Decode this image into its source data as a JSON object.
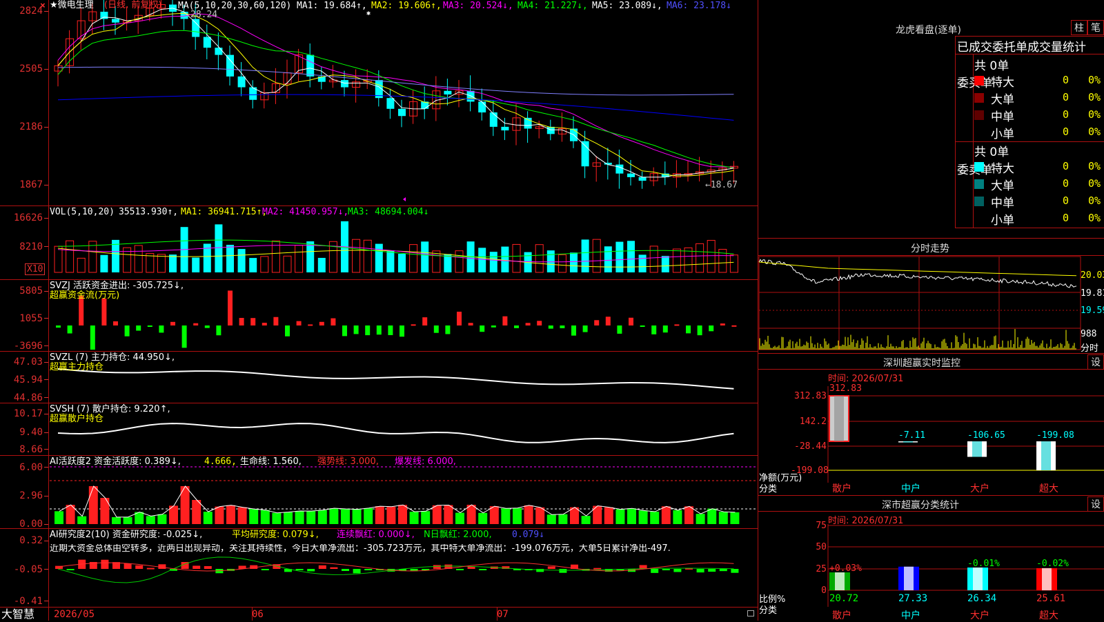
{
  "colors": {
    "up": "#ff2020",
    "down": "#00ffff",
    "ma1": "#ffffff",
    "ma2": "#ffff00",
    "ma3": "#ff00ff",
    "ma4": "#00ff00",
    "ma5": "#8080ff",
    "ma6": "#0000ff",
    "grid": "#b01010",
    "axis": "#e03030"
  },
  "main": {
    "close_icon": "×",
    "title_star": "★微电生理",
    "title_mode": "(日线, 前复权)",
    "ma_params": "MA(5,10,20,30,60,120)",
    "ma1": "MA1: 19.684↑,",
    "ma2": "MA2: 19.606↑,",
    "ma3": "MA3: 20.524↓,",
    "ma4": "MA4: 21.227↓,",
    "ma5": "MA5: 23.089↓,",
    "ma6": "MA6: 23.178↓",
    "high_marker": "28.24",
    "low_marker": "←18.67",
    "y_labels": [
      "2824",
      "2505",
      "2186",
      "1867"
    ]
  },
  "vol": {
    "title": "VOL(5,10,20)",
    "value": "35513.930↑,",
    "ma1": "MA1: 36941.715↑,",
    "ma2": "MA2: 41450.957↓,",
    "ma3": "MA3: 48694.004↓",
    "y_labels": [
      "16626",
      "8210"
    ],
    "unit": "X10"
  },
  "svzj": {
    "title": "SVZJ  活跃资金进出: -305.725↓,",
    "subtitle": "超赢资金流(万元)",
    "y_labels": [
      "5805",
      "1055",
      "-3696"
    ]
  },
  "svzl": {
    "title": "SVZL (7) 主力持仓: 44.950↓,",
    "subtitle": "超赢主力持仓",
    "y_labels": [
      "47.03",
      "45.94",
      "44.86"
    ]
  },
  "svsh": {
    "title": "SVSH (7) 散户持仓: 9.220↑,",
    "subtitle": "超赢散户持仓",
    "y_labels": [
      "10.17",
      "9.40",
      "8.66"
    ]
  },
  "ai1": {
    "title": "AI活跃度2 资金活跃度: 0.389↓,",
    "v2": "4.666,",
    "life": "生命线: 1.560,",
    "strong": "强势线: 3.000,",
    "burst": "爆发线: 6.000,",
    "y_labels": [
      "6.00",
      "2.96",
      "0.00"
    ]
  },
  "ai2": {
    "title": "AI研究度2(10) 资金研究度: -0.025↓,",
    "avg": "平均研究度: 0.079↓,",
    "cont": "连续飘红: 0.000↓,",
    "nday": "N日飘红: 2.000,",
    "last": "0.079↓",
    "comment": "近期大资金总体由空转多，近两日出现异动，关注其持续性，今日大单净流出：-305.723万元，其中特大单净流出：-199.076万元，大单5日累计净出-497.",
    "y_labels": [
      "0.32",
      "-0.05",
      "-0.41"
    ]
  },
  "bottom": {
    "brand": "大智慧",
    "x_labels": [
      "2026/05",
      "06",
      "07"
    ]
  },
  "dragon": {
    "title": "龙虎看盘(逐单)",
    "btn_bar": "柱",
    "btn_pen": "笔",
    "tabs": [
      "已成交",
      "委托单",
      "成交量统计"
    ],
    "buy_label": "委买单",
    "sell_label": "委卖单",
    "buy_total": "共 0单",
    "sell_total": "共 0单",
    "rows": [
      "特大",
      "大单",
      "中单",
      "小单"
    ],
    "buy_rows": [
      {
        "count": "0",
        "pct": "0%"
      },
      {
        "count": "0",
        "pct": "0%"
      },
      {
        "count": "0",
        "pct": "0%"
      },
      {
        "count": "0",
        "pct": "0%"
      }
    ],
    "sell_rows": [
      {
        "count": "0",
        "pct": "0%"
      },
      {
        "count": "0",
        "pct": "0%"
      },
      {
        "count": "0",
        "pct": "0%"
      },
      {
        "count": "0",
        "pct": "0%"
      }
    ],
    "buy_colors": [
      "#ff0000",
      "#8b0000",
      "#600000",
      ""
    ],
    "sell_colors": [
      "#00ffff",
      "#008080",
      "#006060",
      ""
    ]
  },
  "intraday": {
    "title": "分时走势",
    "y_labels": [
      "20.03",
      "19.81",
      "19.59",
      "988"
    ],
    "footer": "分时"
  },
  "monitor": {
    "title": "深圳超赢实时监控",
    "btn": "设",
    "time": "时间: 2026/07/31",
    "y_labels": [
      "312.83",
      "142.2",
      "-28.44",
      "-199.08"
    ],
    "axis_title": "净额(万元)",
    "axis_cat": "分类",
    "categories": [
      "散户",
      "中户",
      "大户",
      "超大"
    ],
    "values": [
      "312.83",
      "-7.11",
      "-106.65",
      "-199.08"
    ]
  },
  "classify": {
    "title": "深市超赢分类统计",
    "btn": "设",
    "time": "时间: 2026/07/31",
    "y_labels": [
      "75",
      "50",
      "25",
      "0"
    ],
    "axis_title": "比例%",
    "axis_cat": "分类",
    "categories": [
      "散户",
      "中户",
      "大户",
      "超大"
    ],
    "changes": [
      "+0.03%",
      "",
      "-0.01%",
      "-0.02%"
    ],
    "values": [
      "20.72",
      "27.33",
      "26.34",
      "25.61"
    ]
  }
}
